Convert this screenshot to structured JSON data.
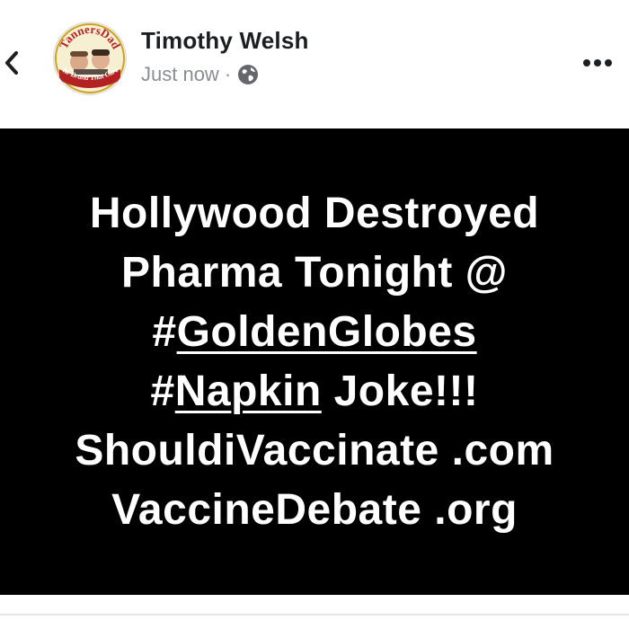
{
  "header": {
    "back_icon": "chevron-left-icon",
    "author_name": "Timothy Welsh",
    "timestamp": "Just now",
    "separator": "·",
    "privacy_icon": "globe-icon",
    "more_icon": "more-horizontal-icon",
    "avatar": {
      "top_text": "TannersDad",
      "bottom_text": "The Brand That Cares"
    }
  },
  "post": {
    "background_color": "#000000",
    "text_color": "#ffffff",
    "lines": [
      {
        "parts": [
          {
            "text": "Hollywood Destroyed",
            "underline": false
          }
        ]
      },
      {
        "parts": [
          {
            "text": "Pharma Tonight @",
            "underline": false
          }
        ]
      },
      {
        "parts": [
          {
            "text": "#",
            "underline": false
          },
          {
            "text": "GoldenGlobes",
            "underline": true
          }
        ]
      },
      {
        "parts": [
          {
            "text": "#",
            "underline": false
          },
          {
            "text": "Napkin",
            "underline": true
          },
          {
            "text": " Joke!!!",
            "underline": false
          }
        ]
      },
      {
        "parts": [
          {
            "text": "ShouldiVaccinate .com",
            "underline": false
          }
        ]
      },
      {
        "parts": [
          {
            "text": "VaccineDebate .org",
            "underline": false
          }
        ]
      }
    ]
  }
}
